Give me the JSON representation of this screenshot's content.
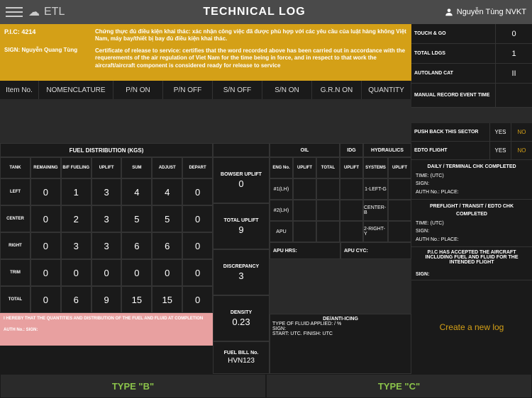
{
  "header": {
    "app": "ETL",
    "title": "TECHNICAL LOG",
    "user": "Nguyễn Tùng NVKT"
  },
  "pic": {
    "code": "P.I.C: 4214",
    "sign": "SIGN: Nguyễn Quang Tùng"
  },
  "cert": {
    "vn": "Chứng thực đủ điều kiện khai thác: xác nhận công việc đã được phù hợp với các yêu cầu của luật hàng không Việt Nam, máy bay/thiết bị bay đủ điều kiện khai thác.",
    "en": "Certificate of release to service: certifies that the word recorded above has been carried out in accordance with the requerements of the air regulation of Viet Nam for the time being in force, and in respect to that work the aircraft/aircraft component is considered ready for release to service"
  },
  "nomen": [
    "Item No.",
    "NOMENCLATURE",
    "P/N ON",
    "P/N OFF",
    "S/N OFF",
    "S/N ON",
    "G.R.N ON",
    "QUANTITY"
  ],
  "status": {
    "touch_go": {
      "label": "TOUCH & GO",
      "val": "0"
    },
    "total_ldgs": {
      "label": "TOTAL LDGS",
      "val": "1"
    },
    "autoland": {
      "label": "AUTOLAND CAT",
      "val": "II"
    },
    "manual_rec": {
      "label": "MANUAL RECORD EVENT TIME",
      "val": ""
    },
    "pushback": {
      "label": "PUSH BACK THIS SECTOR",
      "yes": "YES",
      "no": "NO"
    },
    "edto": {
      "label": "EDTO FLIGHT",
      "yes": "YES",
      "no": "NO"
    }
  },
  "chk1": {
    "title": "DAILY / TERMINAL CHK COMPLETED",
    "time": "TIME:   (UTC)",
    "sign": "SIGN:",
    "auth": "AUTH No.:   PLACE:"
  },
  "chk2": {
    "title": "PREFLIGHT / TRANSIT / EDTO CHK COMPLETED",
    "time": "TIME:   (UTC)",
    "sign": "SIGN:",
    "auth": "AUTH No.:   PLACE:"
  },
  "accepted": {
    "text": "P.I.C HAS ACCEPTED THE AIRCRAFT INCLUDING FUEL AND FLUID FOR THE INTENDED FLIGHT",
    "sign": "SIGN:"
  },
  "newlog": "Create a new log",
  "fuel": {
    "header": "FUEL DISTRIBUTION (KGS)",
    "cols": [
      "TANK",
      "REMAINING",
      "B/F FUELING",
      "UPLIFT",
      "SUM",
      "ADJUST",
      "DEPART"
    ],
    "rows": [
      {
        "lbl": "LEFT",
        "v": [
          "0",
          "1",
          "3",
          "4",
          "4",
          "0"
        ]
      },
      {
        "lbl": "CENTER",
        "v": [
          "0",
          "2",
          "3",
          "5",
          "5",
          "0"
        ]
      },
      {
        "lbl": "RIGHT",
        "v": [
          "0",
          "3",
          "3",
          "6",
          "6",
          "0"
        ]
      },
      {
        "lbl": "TRIM",
        "v": [
          "0",
          "0",
          "0",
          "0",
          "0",
          "0"
        ]
      },
      {
        "lbl": "TOTAL",
        "v": [
          "0",
          "6",
          "9",
          "15",
          "15",
          "0"
        ]
      }
    ]
  },
  "mid": {
    "bowser": {
      "lbl": "BOWSER UPLIFT",
      "val": "0"
    },
    "uplift": {
      "lbl": "TOTAL UPLIFT",
      "val": "9"
    },
    "disc": {
      "lbl": "DISCREPANCY",
      "val": "3"
    },
    "dens": {
      "lbl": "DENSITY",
      "val": "0.23"
    }
  },
  "oil": {
    "hdrs": {
      "oil": "OIL",
      "idg": "IDG",
      "hyd": "HYDRAULICS"
    },
    "cols": [
      "ENG No.",
      "UPLIFT",
      "TOTAL",
      "UPLIFT",
      "SYSTEMS",
      "UPLIFT"
    ],
    "rows": [
      {
        "eng": "#1(LH)",
        "sys": "1-LEFT-G"
      },
      {
        "eng": "#2(LH)",
        "sys": "CENTER-B"
      },
      {
        "eng": "APU",
        "sys": "2-RIGHT-Y"
      }
    ],
    "apu_hrs": "APU HRS:",
    "apu_cyc": "APU CYC:"
  },
  "hereby": {
    "text": "I HEREBY THAT THE QUANTITIES AND DISTRIBUTION OF THE FUEL AND FLUID AT COMPLETION",
    "auth": "AUTH No.:   SIGN:"
  },
  "fuelbill": {
    "lbl": "FUEL BILL No.",
    "val": "HVN123"
  },
  "deice": {
    "title": "DE/ANTI-ICING",
    "type": "TYPE OF FLUID APPLIED: / %",
    "sign": "SIGN:",
    "time": "START: UTC. FINISH: UTC"
  },
  "footer": {
    "b": "TYPE \"B\"",
    "c": "TYPE \"C\""
  }
}
